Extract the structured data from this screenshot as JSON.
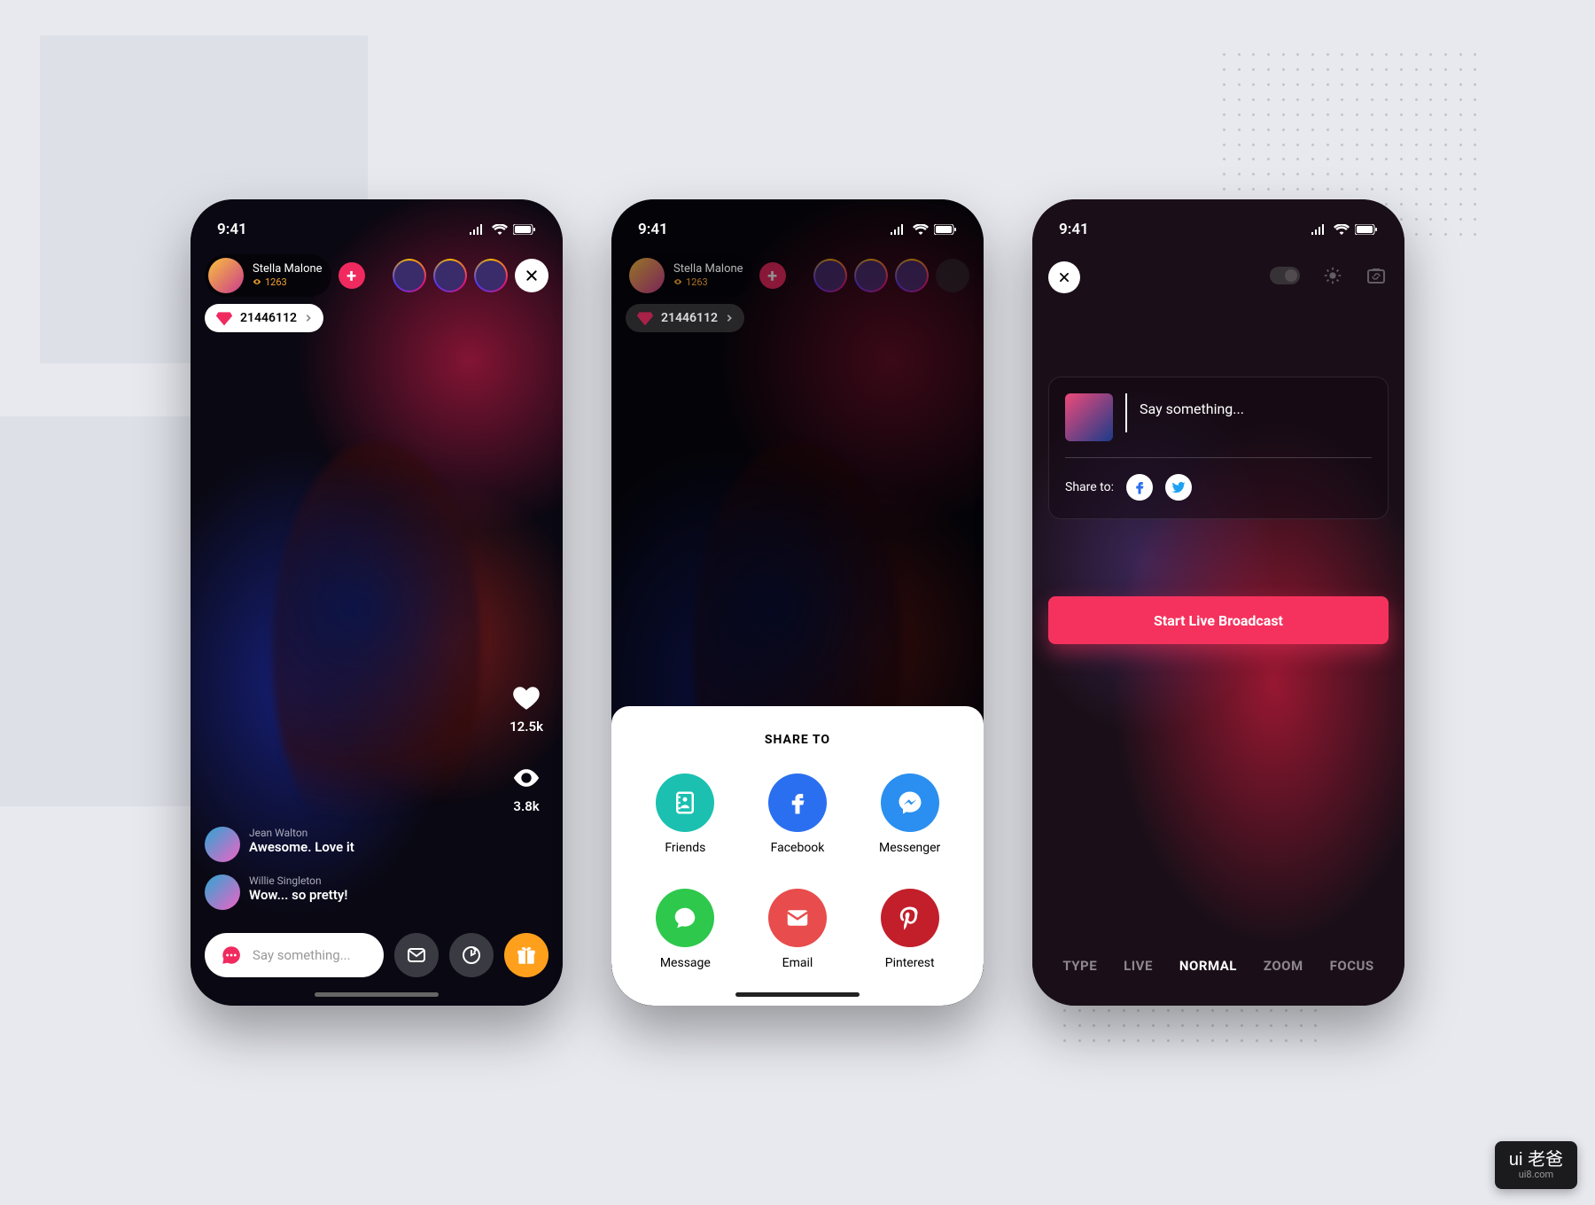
{
  "status_time": "9:41",
  "streamer": {
    "name": "Stella Malone",
    "viewers": "1263"
  },
  "gems": "21446112",
  "likes": "12.5k",
  "watching": "3.8k",
  "comments": [
    {
      "user": "Jean Walton",
      "text": "Awesome. Love it"
    },
    {
      "user": "Willie Singleton",
      "text": "Wow... so pretty!"
    }
  ],
  "input_placeholder": "Say something...",
  "share_sheet": {
    "title": "SHARE TO",
    "options": [
      "Friends",
      "Facebook",
      "Messenger",
      "Message",
      "Email",
      "Pinterest"
    ]
  },
  "p3": {
    "compose_placeholder": "Say something...",
    "share_to_label": "Share to:",
    "start_button": "Start Live Broadcast",
    "modes": [
      "TYPE",
      "LIVE",
      "NORMAL",
      "ZOOM",
      "FOCUS"
    ],
    "active_mode": "NORMAL"
  },
  "watermark": {
    "top": "ui 老爸",
    "url": "ui8.com"
  }
}
